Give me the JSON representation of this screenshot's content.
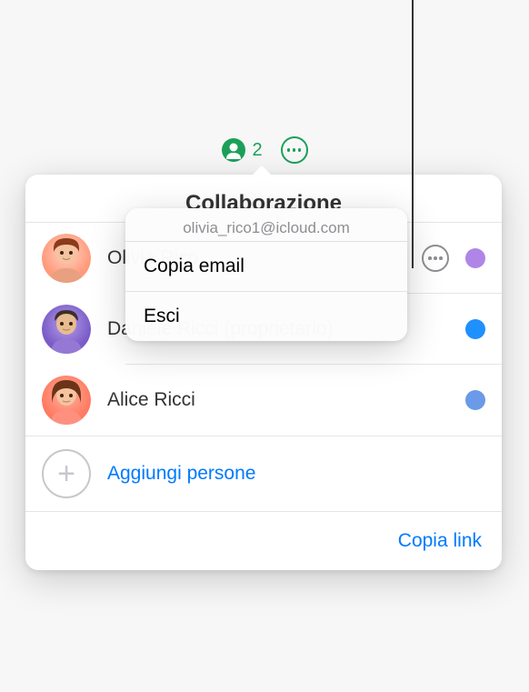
{
  "toolbar": {
    "participant_count": "2"
  },
  "popover": {
    "title": "Collaborazione",
    "add_label": "Aggiungi persone",
    "copy_link_label": "Copia link"
  },
  "participants": [
    {
      "name": "Olivia Rico",
      "presence_color": "#b085e8",
      "show_more": true
    },
    {
      "name": "Daniele Ricci (proprietario)",
      "presence_color": "#1e90ff",
      "show_more": false
    },
    {
      "name": "Alice Ricci",
      "presence_color": "#6a9ae8",
      "show_more": false
    }
  ],
  "context_menu": {
    "email": "olivia_rico1@icloud.com",
    "items": [
      "Copia email",
      "Esci"
    ]
  }
}
